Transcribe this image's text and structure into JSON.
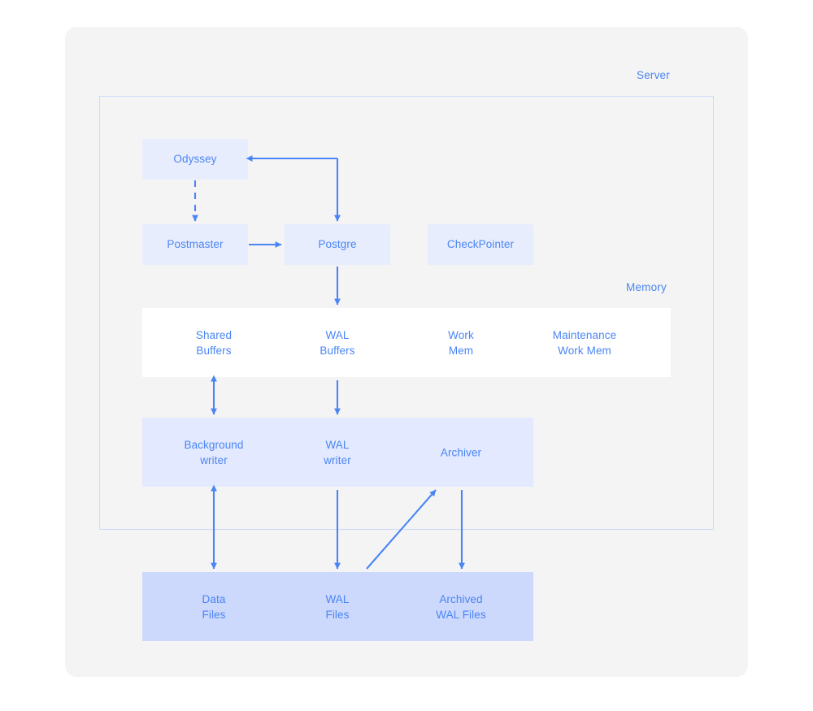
{
  "diagram": {
    "title_caption": "Server",
    "memory_caption": "Memory",
    "colors": {
      "page_background": "#ffffff",
      "card_background": "#f4f4f4",
      "outline_border": "#cddbfa",
      "process_box": "#e8edfd",
      "memory_band": "#ffffff",
      "writer_band": "#e3e9fe",
      "files_band": "#ccd8fc",
      "text_blue": "#4a85f5",
      "arrow_blue": "#4a85f5"
    },
    "nodes": {
      "odyssey": "Odyssey",
      "postmaster": "Postmaster",
      "postgre": "Postgre",
      "checkpointer": "CheckPointer"
    },
    "memory_items": [
      {
        "label": "Shared\nBuffers"
      },
      {
        "label": "WAL\nBuffers"
      },
      {
        "label": "Work\nMem"
      },
      {
        "label": "Maintenance\nWork Mem"
      }
    ],
    "writer_items": [
      {
        "label": "Background\nwriter"
      },
      {
        "label": "WAL\nwriter"
      },
      {
        "label": "Archiver"
      }
    ],
    "file_items": [
      {
        "label": "Data\nFiles"
      },
      {
        "label": "WAL\nFiles"
      },
      {
        "label": "Archived\nWAL Files"
      }
    ],
    "connections": [
      {
        "from": "Odyssey",
        "to": "Postmaster",
        "style": "dashed",
        "direction": "one-way"
      },
      {
        "from": "Postmaster",
        "to": "Postgre",
        "style": "solid",
        "direction": "one-way"
      },
      {
        "from": "Postgre",
        "to": "Odyssey",
        "style": "solid-elbow",
        "direction": "one-way"
      },
      {
        "from": "Postgre",
        "to": "WAL Buffers",
        "style": "solid",
        "direction": "one-way"
      },
      {
        "from": "Shared Buffers",
        "to": "Background writer",
        "style": "solid",
        "direction": "two-way"
      },
      {
        "from": "WAL Buffers",
        "to": "WAL writer",
        "style": "solid",
        "direction": "one-way"
      },
      {
        "from": "Background writer",
        "to": "Data Files",
        "style": "solid",
        "direction": "two-way"
      },
      {
        "from": "WAL writer",
        "to": "WAL Files",
        "style": "solid",
        "direction": "one-way"
      },
      {
        "from": "WAL Files",
        "to": "Archiver",
        "style": "solid-diagonal",
        "direction": "one-way"
      },
      {
        "from": "Archiver",
        "to": "Archived WAL Files",
        "style": "solid",
        "direction": "one-way"
      }
    ]
  }
}
